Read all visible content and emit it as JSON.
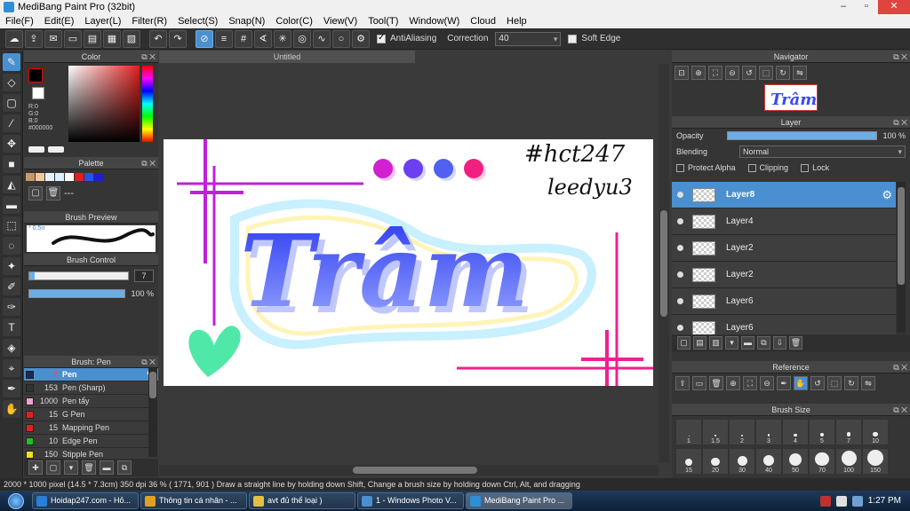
{
  "window": {
    "title": "MediBang Paint Pro (32bit)"
  },
  "menu": [
    "File(F)",
    "Edit(E)",
    "Layer(L)",
    "Filter(R)",
    "Select(S)",
    "Snap(N)",
    "Color(C)",
    "View(V)",
    "Tool(T)",
    "Window(W)",
    "Cloud",
    "Help"
  ],
  "toolbar": {
    "antialiasing_label": "AntiAliasing",
    "correction_label": "Correction",
    "correction_value": "40",
    "soft_edge_label": "Soft Edge"
  },
  "color_panel": {
    "title": "Color",
    "r_label": "R:0",
    "g_label": "G:0",
    "b_label": "B:0",
    "hex": "#000000",
    "fg_color": "#000000",
    "bg_color": "#ffffff"
  },
  "palette": {
    "title": "Palette",
    "swatches": [
      "#c89a6a",
      "#f2c8a0",
      "#e8f0f8",
      "#d8f0ff",
      "#ffffff",
      "#e02020",
      "#3050e0",
      "#2020c0"
    ],
    "dash_label": "---"
  },
  "brush_preview": {
    "title": "Brush Preview",
    "size_label": "* 0.5​n"
  },
  "brush_control": {
    "title": "Brush Control",
    "size_value": "7",
    "opacity_value": "100 %",
    "size_fill": 0.05,
    "opacity_fill": 1.0
  },
  "brushes": {
    "title": "Brush: Pen",
    "items": [
      {
        "size": "7",
        "name": "Pen",
        "color": "#1a2a50"
      },
      {
        "size": "153",
        "name": "Pen (Sharp)",
        "color": "#333333"
      },
      {
        "size": "1000",
        "name": "Pen tẩy",
        "color": "#f0a0d0"
      },
      {
        "size": "15",
        "name": "G Pen",
        "color": "#e02020"
      },
      {
        "size": "15",
        "name": "Mapping Pen",
        "color": "#e02020"
      },
      {
        "size": "10",
        "name": "Edge Pen",
        "color": "#20c020"
      },
      {
        "size": "150",
        "name": "Stipple Pen",
        "color": "#f0e020"
      }
    ]
  },
  "document": {
    "tab_title": "Untitled",
    "hashtag": "#hct247",
    "author": "leedyu3",
    "title_text": "Trâm"
  },
  "navigator": {
    "title": "Navigator"
  },
  "layer_panel": {
    "title": "Layer",
    "opacity_label": "Opacity",
    "opacity_value": "100 %",
    "blending_label": "Blending",
    "blending_value": "Normal",
    "protect_alpha_label": "Protect Alpha",
    "clipping_label": "Clipping",
    "lock_label": "Lock",
    "layers": [
      "Layer8",
      "Layer4",
      "Layer2",
      "Layer2",
      "Layer6",
      "Layer6"
    ]
  },
  "reference": {
    "title": "Reference"
  },
  "brush_size": {
    "title": "Brush Size",
    "sizes": [
      "1",
      "1.5",
      "2",
      "3",
      "4",
      "5",
      "7",
      "10"
    ],
    "bottom_sizes": [
      "15",
      "20",
      "30",
      "40",
      "50",
      "70",
      "100",
      "150"
    ]
  },
  "status": {
    "text": "2000 * 1000 pixel   (14.5 * 7.3cm)   350 dpi   36 %   ( 1771, 901 )   Draw a straight line by holding down Shift, Change a brush size by holding down Ctrl, Alt, and dragging"
  },
  "taskbar": {
    "tasks": [
      {
        "label": "Hoidap247.com - Hỏ...",
        "color": "#2a80d8"
      },
      {
        "label": "Thông tin cá nhân - ...",
        "color": "#e0a020"
      },
      {
        "label": "avt đủ thể loại )",
        "color": "#e0c040"
      },
      {
        "label": "1 - Windows Photo V...",
        "color": "#4a90d0"
      },
      {
        "label": "MediBang Paint Pro ...",
        "color": "#2e8fd8"
      }
    ],
    "clock": "1:27 PM"
  }
}
